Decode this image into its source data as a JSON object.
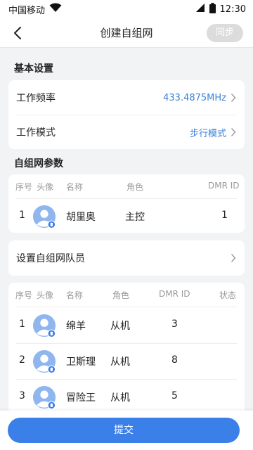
{
  "status_bar": {
    "carrier": "中国移动",
    "time": "12:30"
  },
  "header": {
    "title": "创建自组网",
    "sync_label": "同步"
  },
  "basic": {
    "section_title": "基本设置",
    "frequency_label": "工作频率",
    "frequency_value": "433.4875MHz",
    "mode_label": "工作模式",
    "mode_value": "步行模式"
  },
  "params": {
    "section_title": "自组网参数",
    "columns": {
      "index": "序号",
      "avatar": "头像",
      "name": "名称",
      "role": "角色",
      "dmr": "DMR ID"
    },
    "rows": [
      {
        "index": "1",
        "name": "胡里奥",
        "role": "主控",
        "dmr": "1"
      }
    ]
  },
  "members_entry": {
    "label": "设置自组网队员"
  },
  "members": {
    "columns": {
      "index": "序号",
      "avatar": "头像",
      "name": "名称",
      "role": "角色",
      "dmr": "DMR ID",
      "status": "状态"
    },
    "rows": [
      {
        "index": "1",
        "name": "绵羊",
        "role": "从机",
        "dmr": "3"
      },
      {
        "index": "2",
        "name": "卫斯理",
        "role": "从机",
        "dmr": "8"
      },
      {
        "index": "3",
        "name": "冒险王",
        "role": "从机",
        "dmr": "5"
      }
    ]
  },
  "footer": {
    "submit_label": "提交"
  },
  "colors": {
    "accent": "#3b7fe8",
    "value_blue": "#3b82d6",
    "avatar_bg": "#8fb6ee",
    "disabled": "#dcdcdc"
  },
  "icons": [
    "back-arrow-icon",
    "chevron-right-icon",
    "person-icon",
    "wifi-icon",
    "signal-icon",
    "battery-icon"
  ]
}
